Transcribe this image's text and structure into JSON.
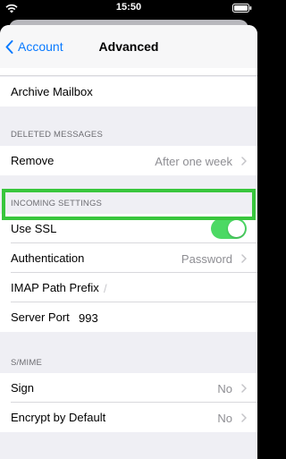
{
  "status_bar": {
    "time": "15:50"
  },
  "navbar": {
    "back_label": "Account",
    "title": "Advanced"
  },
  "rows": {
    "archive_mailbox": {
      "label": "Archive Mailbox"
    },
    "remove": {
      "label": "Remove",
      "value": "After one week"
    },
    "use_ssl": {
      "label": "Use SSL",
      "enabled": true
    },
    "authentication": {
      "label": "Authentication",
      "value": "Password"
    },
    "imap_path_prefix": {
      "label": "IMAP Path Prefix",
      "value": "/"
    },
    "server_port": {
      "label": "Server Port",
      "value": "993"
    },
    "sign": {
      "label": "Sign",
      "value": "No"
    },
    "encrypt_by_default": {
      "label": "Encrypt by Default",
      "value": "No"
    }
  },
  "sections": {
    "deleted_messages": "DELETED MESSAGES",
    "incoming_settings": "INCOMING SETTINGS",
    "smime": "S/MIME"
  },
  "colors": {
    "accent": "#0a7aff",
    "toggle_on": "#4cd964",
    "highlight": "#39c63d"
  }
}
